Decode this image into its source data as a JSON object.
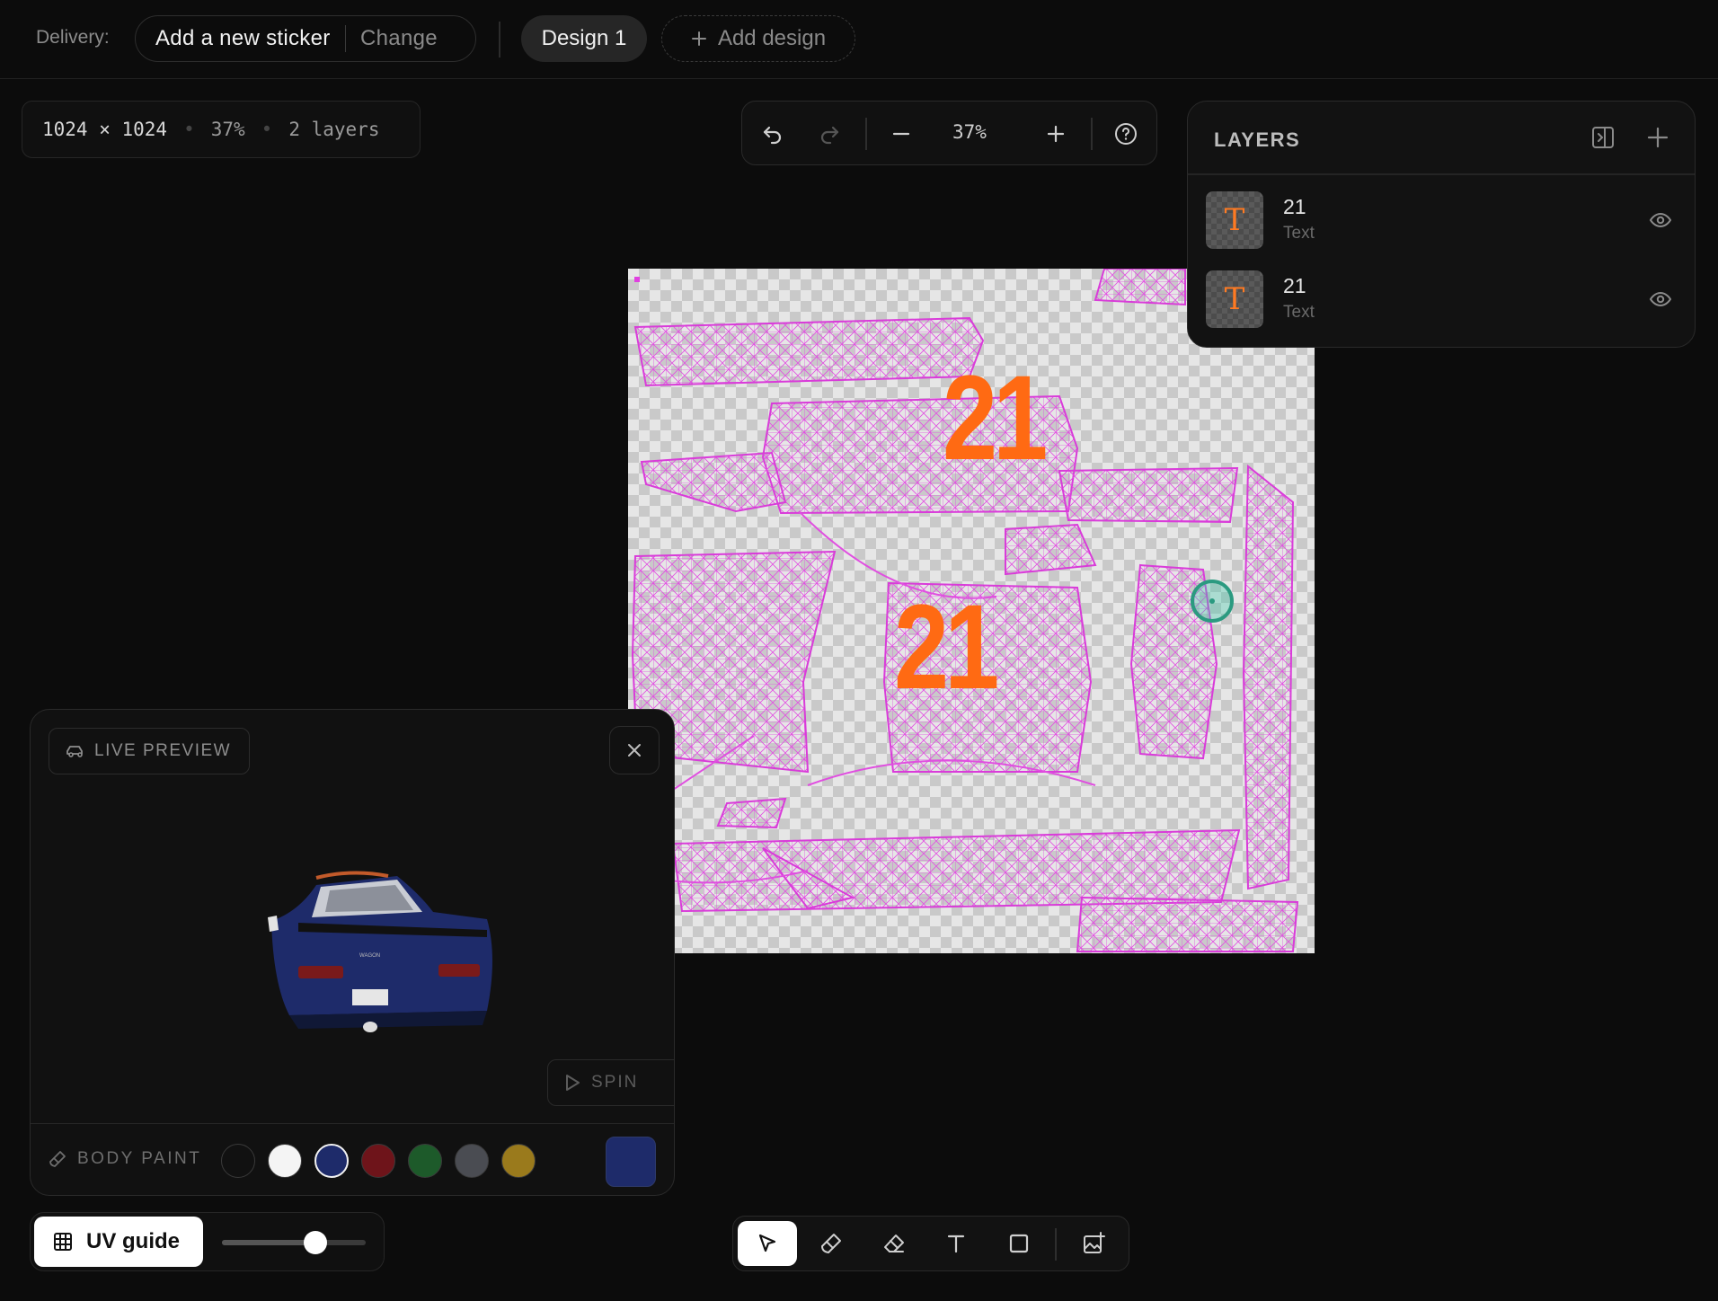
{
  "topbar": {
    "delivery_label": "Delivery:",
    "sticker_value": "Add a new sticker",
    "change_label": "Change",
    "design_tab": "Design 1",
    "add_design_label": "Add design"
  },
  "info": {
    "dimensions": "1024 × 1024",
    "zoom": "37%",
    "layers_count": "2 layers"
  },
  "view_toolbar": {
    "zoom_value": "37%",
    "icons": [
      "undo-icon",
      "redo-icon",
      "zoom-out-icon",
      "zoom-in-icon",
      "help-icon"
    ]
  },
  "canvas": {
    "texts": [
      "21",
      "21"
    ],
    "accent_text_color": "#ff6a13",
    "uv_line_color": "#e050e0"
  },
  "layers": {
    "title": "LAYERS",
    "items": [
      {
        "name": "21",
        "type": "Text",
        "thumb_glyph": "T"
      },
      {
        "name": "21",
        "type": "Text",
        "thumb_glyph": "T"
      }
    ]
  },
  "live_preview": {
    "title": "LIVE PREVIEW",
    "spin_label": "SPIN",
    "body_paint_label": "BODY PAINT",
    "swatches": [
      "#111111",
      "#f4f4f4",
      "#1e2b6a",
      "#6e141a",
      "#1d5a2a",
      "#4a4c52",
      "#9a7a1c"
    ],
    "selected_swatch": "#1e2b6a",
    "current_color": "#1e2b6a",
    "plate_text": "WAGON"
  },
  "uv_guide": {
    "label": "UV guide",
    "opacity": 0.65
  },
  "bottom_tools": {
    "tools": [
      "select-tool",
      "brush-tool",
      "eraser-tool",
      "text-tool",
      "rectangle-tool",
      "image-tool"
    ],
    "active": "select-tool"
  }
}
